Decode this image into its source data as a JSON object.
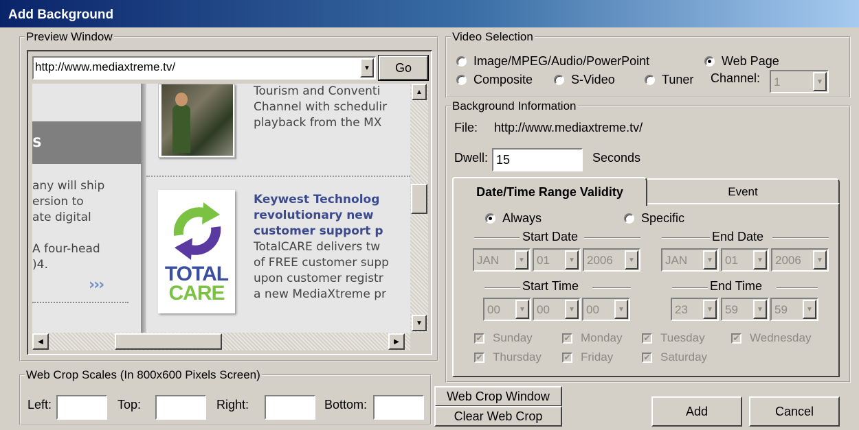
{
  "window": {
    "title": "Add Background"
  },
  "preview": {
    "legend": "Preview Window",
    "url": "http://www.mediaxtreme.tv/",
    "go_label": "Go",
    "web_content": {
      "left_fragment_s": "S",
      "left_lines": [
        "any will ship",
        "ersion to",
        "ate digital",
        "",
        "A four-head",
        ")4."
      ],
      "left_chevrons": "›››",
      "item1_lines": [
        "Tourism and Conventi",
        "Channel with schedulir",
        "playback from the MX"
      ],
      "item2_title_lines": [
        "Keywest Technolog",
        "revolutionary new",
        "customer support p"
      ],
      "item2_body_lines": [
        "TotalCARE delivers tw",
        "of FREE customer supp",
        "upon customer registr",
        "a new MediaXtreme pr"
      ],
      "logo_text_1": "TOTAL",
      "logo_text_2": "CARE"
    }
  },
  "video_selection": {
    "legend": "Video Selection",
    "options": [
      {
        "label": "Image/MPEG/Audio/PowerPoint",
        "selected": false
      },
      {
        "label": "Web Page",
        "selected": true
      },
      {
        "label": "Composite",
        "selected": false
      },
      {
        "label": "S-Video",
        "selected": false
      },
      {
        "label": "Tuner",
        "selected": false
      }
    ],
    "channel_label": "Channel:",
    "channel_value": "1"
  },
  "background_info": {
    "legend": "Background Information",
    "file_label": "File:",
    "file_value": "http://www.mediaxtreme.tv/",
    "dwell_label": "Dwell:",
    "dwell_value": "15",
    "seconds_label": "Seconds"
  },
  "tabs": [
    {
      "label": "Date/Time Range Validity",
      "active": true
    },
    {
      "label": "Event",
      "active": false
    }
  ],
  "validity": {
    "always_label": "Always",
    "specific_label": "Specific",
    "always_selected": true,
    "start_date_label": "Start Date",
    "end_date_label": "End Date",
    "start_time_label": "Start Time",
    "end_time_label": "End Time",
    "start_date": {
      "month": "JAN",
      "day": "01",
      "year": "2006"
    },
    "end_date": {
      "month": "JAN",
      "day": "01",
      "year": "2006"
    },
    "start_time": {
      "h": "00",
      "m": "00",
      "s": "00"
    },
    "end_time": {
      "h": "23",
      "m": "59",
      "s": "59"
    },
    "days": [
      {
        "label": "Sunday",
        "checked": true
      },
      {
        "label": "Monday",
        "checked": true
      },
      {
        "label": "Tuesday",
        "checked": true
      },
      {
        "label": "Wednesday",
        "checked": true
      },
      {
        "label": "Thursday",
        "checked": true
      },
      {
        "label": "Friday",
        "checked": true
      },
      {
        "label": "Saturday",
        "checked": true
      }
    ]
  },
  "web_crop": {
    "legend": "Web Crop Scales (In 800x600  Pixels Screen)",
    "left_label": "Left:",
    "top_label": "Top:",
    "right_label": "Right:",
    "bottom_label": "Bottom:",
    "left_value": "",
    "top_value": "",
    "right_value": "",
    "bottom_value": "",
    "window_button": "Web Crop Window",
    "clear_button": "Clear Web Crop"
  },
  "actions": {
    "add": "Add",
    "cancel": "Cancel"
  },
  "icons": {
    "checkmark": "check-icon",
    "dropdown": "chevron-down-icon"
  }
}
